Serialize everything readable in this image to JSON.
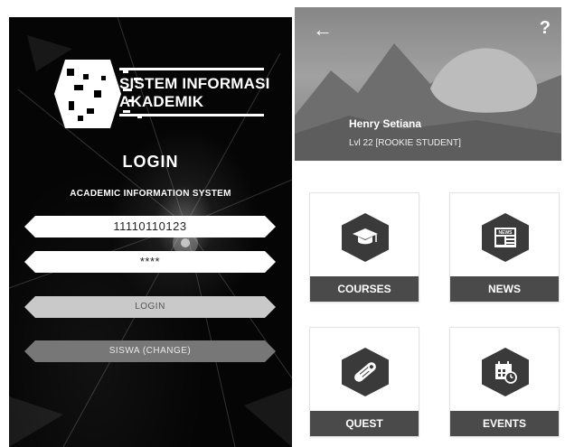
{
  "login_screen": {
    "logo_line1": "SISTEM INFORMASI",
    "logo_line2": "AKADEMIK",
    "title": "LOGIN",
    "subtitle": "ACADEMIC INFORMATION SYSTEM",
    "username_value": "11110110123",
    "password_value": "****",
    "login_button": "LOGIN",
    "change_button": "SISWA (CHANGE)"
  },
  "dashboard_screen": {
    "back_icon": "arrow-left-icon",
    "help_label": "?",
    "user_name": "Henry Setiana",
    "user_level": "Lvl 22 [ROOKIE STUDENT]",
    "menu": [
      {
        "label": "COURSES",
        "icon": "graduation-cap-icon"
      },
      {
        "label": "NEWS",
        "icon": "newspaper-icon"
      },
      {
        "label": "QUEST",
        "icon": "scroll-icon"
      },
      {
        "label": "EVENTS",
        "icon": "calendar-clock-icon"
      }
    ]
  },
  "colors": {
    "login_bg": "#050505",
    "tile_bar": "#4a4a4a",
    "icon_hex": "#3a3a3a"
  }
}
